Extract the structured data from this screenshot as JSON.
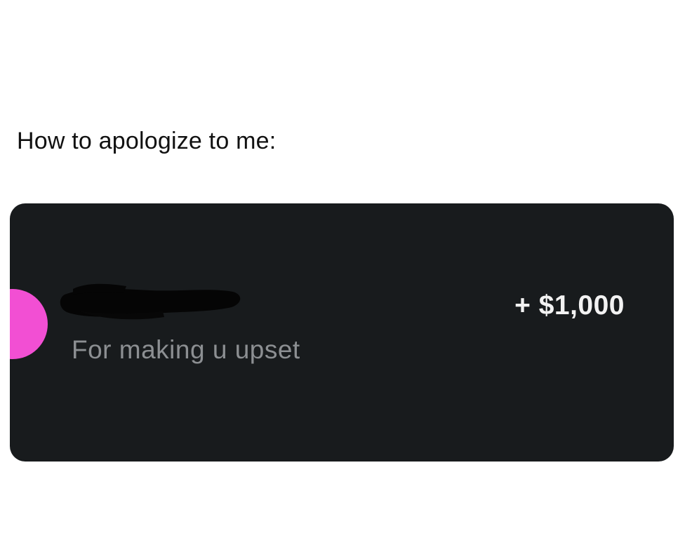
{
  "caption": "How to apologize to me:",
  "transaction": {
    "sender_name": "",
    "memo": "For making u upset",
    "amount": "+ $1,000",
    "avatar_color": "#f24fd3",
    "card_background": "#181b1d",
    "name_redacted": true
  }
}
